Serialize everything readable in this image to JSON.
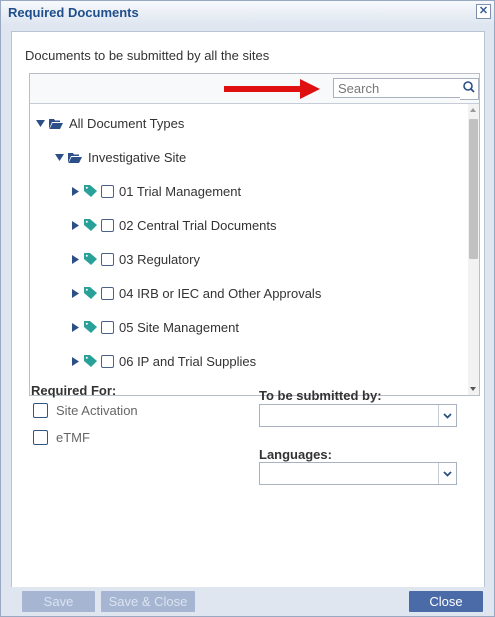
{
  "dialog": {
    "title": "Required Documents",
    "close_symbol": "✕",
    "heading": "Documents to be submitted by all the sites"
  },
  "search": {
    "placeholder": "Search",
    "value": ""
  },
  "annotation": {
    "arrow_color": "#e01010"
  },
  "tree": {
    "root": {
      "label": "All Document Types",
      "expanded": true
    },
    "site": {
      "label": "Investigative Site",
      "expanded": true
    },
    "items": [
      {
        "label": "01 Trial Management",
        "checked": false
      },
      {
        "label": "02 Central Trial Documents",
        "checked": false
      },
      {
        "label": "03 Regulatory",
        "checked": false
      },
      {
        "label": "04 IRB or IEC and Other Approvals",
        "checked": false
      },
      {
        "label": "05 Site Management",
        "checked": false
      },
      {
        "label": "06 IP and Trial Supplies",
        "checked": false
      }
    ]
  },
  "required_for": {
    "label": "Required For:",
    "options": [
      {
        "label": "Site Activation",
        "checked": false
      },
      {
        "label": "eTMF",
        "checked": false
      }
    ]
  },
  "submitted_by": {
    "label": "To be submitted by:",
    "value": ""
  },
  "languages": {
    "label": "Languages:",
    "value": ""
  },
  "footer": {
    "save": "Save",
    "save_close": "Save & Close",
    "close": "Close"
  },
  "colors": {
    "accent": "#4a6ba8",
    "title": "#1f4e8c",
    "tag": "#2aa198",
    "folder": "#2b4f86"
  }
}
